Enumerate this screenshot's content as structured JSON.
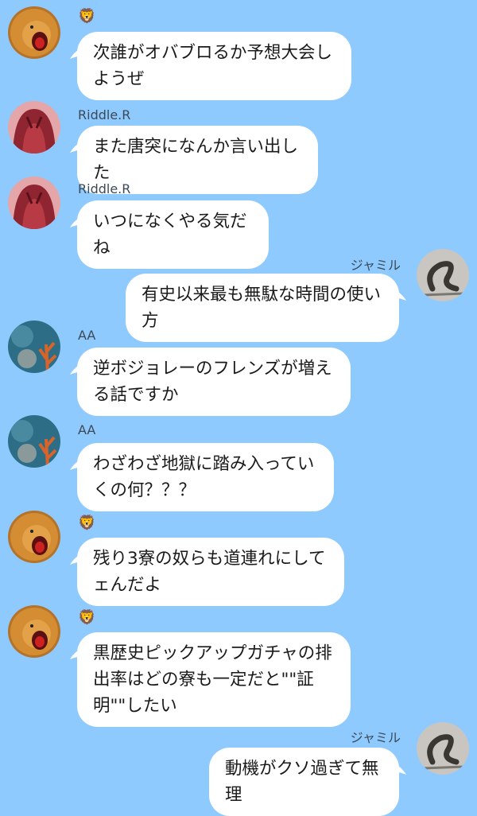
{
  "messages": [
    {
      "side": "left",
      "sender": "🦁",
      "sender_is_emoji": true,
      "avatar": "lion-avatar",
      "text": "次誰がオバブロるか予想大会しようぜ"
    },
    {
      "side": "left",
      "sender": "Riddle.R",
      "avatar": "red-hair-avatar",
      "text": "また唐突になんか言い出した"
    },
    {
      "side": "left",
      "sender": "Riddle.R",
      "avatar": "red-hair-avatar",
      "text": "いつになくやる気だね"
    },
    {
      "side": "right",
      "sender": "ジャミル",
      "avatar": "snake-avatar",
      "text": "有史以来最も無駄な時間の使い方"
    },
    {
      "side": "left",
      "sender": "AA",
      "avatar": "coral-avatar",
      "text": "逆ボジョレーのフレンズが増える話ですか"
    },
    {
      "side": "left",
      "sender": "AA",
      "avatar": "coral-avatar",
      "text": "わざわざ地獄に踏み入っていくの何？？？"
    },
    {
      "side": "left",
      "sender": "🦁",
      "sender_is_emoji": true,
      "avatar": "lion-avatar",
      "text": "残り3寮の奴らも道連れにしてェんだよ"
    },
    {
      "side": "left",
      "sender": "🦁",
      "sender_is_emoji": true,
      "avatar": "lion-avatar",
      "text": "黒歴史ピックアップガチャの排出率はどの寮も一定だと\"\"証明\"\"したい"
    },
    {
      "side": "right",
      "sender": "ジャミル",
      "avatar": "snake-avatar",
      "text": "動機がクソ過ぎて無理"
    }
  ],
  "colors": {
    "background": "#8fcaff",
    "bubble": "#ffffff"
  }
}
